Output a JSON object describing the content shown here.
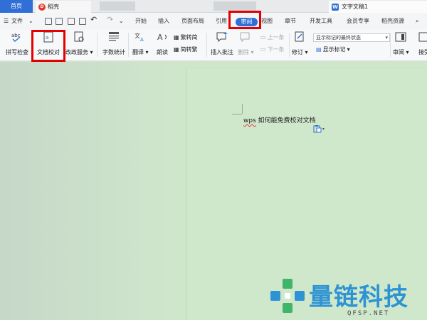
{
  "tabs": {
    "home": "首页",
    "docer": "稻壳",
    "document": "文字文稿1"
  },
  "menu": {
    "file": "文件",
    "items": [
      "开始",
      "插入",
      "页面布局",
      "引用",
      "审阅",
      "视图",
      "章节",
      "开发工具",
      "会员专享",
      "稻壳资源"
    ],
    "active": "审阅"
  },
  "ribbon": {
    "spell_check": "拼写检查",
    "doc_proofread": "文档校对",
    "revise_service": "改政服务",
    "word_count": "字数统计",
    "translate": "翻译",
    "read_aloud": "朗读",
    "to_traditional": "繁转简",
    "to_simplified": "简转繁",
    "insert_comment": "插入批注",
    "delete": "删除",
    "prev": "上一条",
    "next": "下一条",
    "track_changes": "修订",
    "markup_select": "显示标记的最终状态",
    "show_markup": "显示标记",
    "review": "审阅",
    "accept": "接受"
  },
  "document": {
    "prefix": "wps",
    "text": " 如何能免费校对文档"
  },
  "watermark": {
    "title": "量链科技",
    "url": "QFSP.NET"
  },
  "colors": {
    "accent": "#2f6fd6",
    "highlight": "#e30000",
    "workspace": "#cfe6cc",
    "watermark": "#2e93d3"
  }
}
